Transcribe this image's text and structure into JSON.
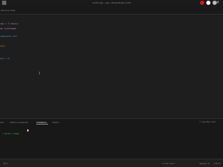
{
  "window": {
    "title": "cardio.cpp - cpp - Visual Studio Code"
  },
  "menu": [
    "Terminal",
    "Help"
  ],
  "editor": {
    "lines": [
      "cpp > ⓕ main()",
      "de <iostream>",
      "namespace std;",
      "in()",
      "ahs = 0;"
    ]
  },
  "panel": {
    "tabs": [
      "PUT",
      "DEBUG CONSOLE",
      "TERMINAL",
      "PORTS"
    ],
    "active_tab": "TERMINAL",
    "terminal_name": "cppdbg: main",
    "terminal_prompt": "r-mint:~/cpp$"
  },
  "status": {
    "left": "Ⓦ 0",
    "position": "Ln 10, Col 1",
    "spaces": "Spaces: 4",
    "encoding": "UTF-8"
  },
  "colors": {
    "background": "#1e1e1e",
    "accent": "#d07bff",
    "prompt": "#30d05a",
    "comment": "#39b36b",
    "keyword": "#4ea0e0",
    "string": "#e7b36a"
  },
  "icons": {
    "app": "vscode-icon",
    "system": [
      "status-icon-red",
      "status-icon-white",
      "status-icon-gray"
    ],
    "close": "close-icon"
  }
}
